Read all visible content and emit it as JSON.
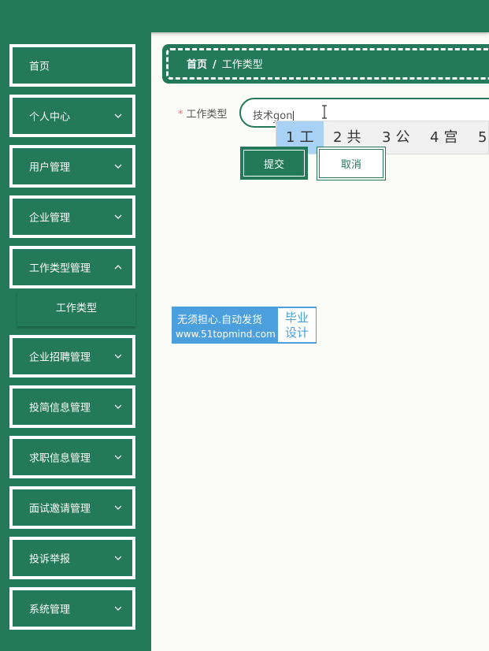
{
  "sidebar": {
    "items": [
      {
        "label": "首页",
        "has_chevron": false
      },
      {
        "label": "个人中心",
        "has_chevron": true
      },
      {
        "label": "用户管理",
        "has_chevron": true
      },
      {
        "label": "企业管理",
        "has_chevron": true
      },
      {
        "label": "工作类型管理",
        "has_chevron": true,
        "expanded": true
      },
      {
        "label": "企业招聘管理",
        "has_chevron": true
      },
      {
        "label": "投简信息管理",
        "has_chevron": true
      },
      {
        "label": "求职信息管理",
        "has_chevron": true
      },
      {
        "label": "面试邀请管理",
        "has_chevron": true
      },
      {
        "label": "投诉举报",
        "has_chevron": true
      },
      {
        "label": "系统管理",
        "has_chevron": true
      }
    ],
    "submenu": {
      "label": "工作类型"
    }
  },
  "breadcrumb": {
    "home": "首页",
    "separator": "/",
    "current": "工作类型"
  },
  "form": {
    "required_mark": "*",
    "field_label": "工作类型",
    "input_committed": "技术",
    "input_pinyin": "gon",
    "submit_label": "提交",
    "cancel_label": "取消"
  },
  "ime": {
    "candidates": [
      {
        "num": "1",
        "text": "工"
      },
      {
        "num": "2",
        "text": "共"
      },
      {
        "num": "3",
        "text": "公"
      },
      {
        "num": "4",
        "text": "宫"
      },
      {
        "num": "5",
        "text": ""
      }
    ],
    "active_index": 0
  },
  "watermark": {
    "line1": "无须担心.自动发货",
    "line2": "www.51topmind.com",
    "badge_line1": "毕业",
    "badge_line2": "设计"
  },
  "colors": {
    "primary": "#23795a",
    "required": "#f56c6c",
    "ime_highlight": "#a8d1f5",
    "watermark": "#4a9fdc"
  }
}
